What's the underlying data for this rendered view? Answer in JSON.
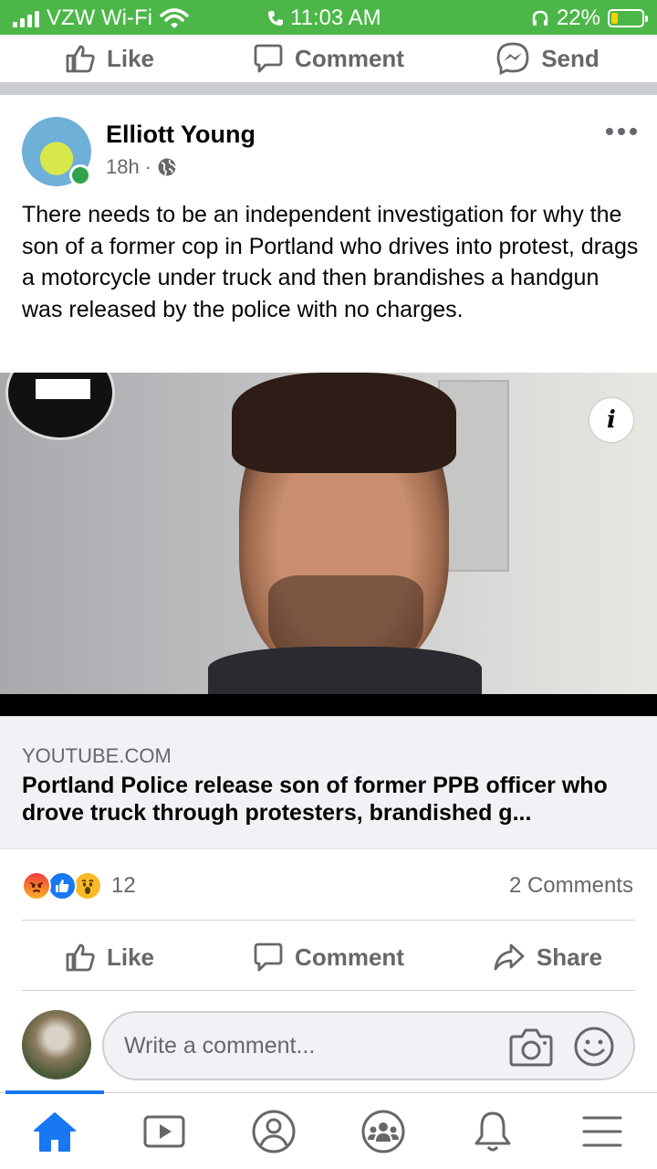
{
  "status_bar": {
    "carrier": "VZW Wi-Fi",
    "time": "11:03 AM",
    "battery": "22%",
    "battery_level": 0.22
  },
  "previous_post_actions": {
    "like": "Like",
    "comment": "Comment",
    "send": "Send"
  },
  "post": {
    "author": "Elliott Young",
    "time": "18h",
    "separator": "·",
    "text": "There needs to be an independent investigation for why the son of a former cop in Portland who drives into protest, drags a motorcycle under truck and then brandishes a handgun was released by the police with no charges.",
    "link": {
      "domain": "YOUTUBE.COM",
      "title": "Portland Police release son of former PPB officer who drove truck through protesters, brandished g..."
    },
    "reaction_count": "12",
    "comment_count": "2 Comments",
    "actions": {
      "like": "Like",
      "comment": "Comment",
      "share": "Share"
    }
  },
  "composer": {
    "placeholder": "Write a comment..."
  },
  "nav": {
    "items": [
      "home-icon",
      "watch-icon",
      "profile-icon",
      "groups-icon",
      "notifications-icon",
      "menu-icon"
    ],
    "active": "home-icon"
  },
  "colors": {
    "status_bar": "#4cb748",
    "accent": "#1877f2",
    "secondary_text": "#65676b",
    "online": "#31a24c"
  }
}
